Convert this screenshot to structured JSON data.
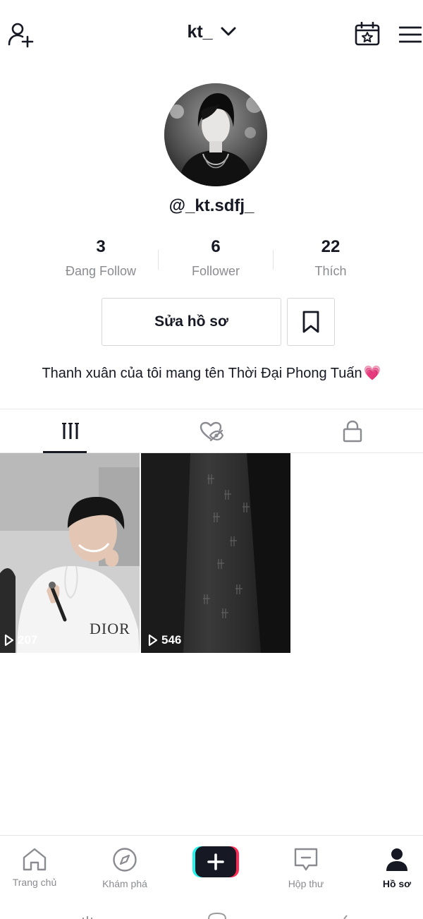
{
  "header": {
    "username": "kt_",
    "icons": [
      "add-user-icon",
      "chevron-down-icon",
      "calendar-star-icon",
      "menu-icon"
    ]
  },
  "profile": {
    "handle": "@_kt.sdfj_",
    "stats": [
      {
        "value": "3",
        "label": "Đang Follow"
      },
      {
        "value": "6",
        "label": "Follower"
      },
      {
        "value": "22",
        "label": "Thích"
      }
    ],
    "edit_label": "Sửa hồ sơ",
    "bio": "Thanh xuân của tôi mang tên Thời Đại Phong Tuấn",
    "bio_emoji": "💗"
  },
  "tabs": [
    "videos-grid-icon",
    "liked-hidden-icon",
    "lock-icon"
  ],
  "videos": [
    {
      "views": "207",
      "overlay_text": "DIOR"
    },
    {
      "views": "546"
    }
  ],
  "bottom_nav": [
    {
      "label": "Trang chủ",
      "icon": "home-icon"
    },
    {
      "label": "Khám phá",
      "icon": "compass-icon"
    },
    {
      "label": "",
      "icon": "plus-icon"
    },
    {
      "label": "Hộp thư",
      "icon": "inbox-icon"
    },
    {
      "label": "Hồ sơ",
      "icon": "profile-icon"
    }
  ],
  "colors": {
    "accent_pink": "#fe2c55",
    "accent_cyan": "#25f4ee",
    "text": "#161823",
    "muted": "#8a8b91"
  }
}
